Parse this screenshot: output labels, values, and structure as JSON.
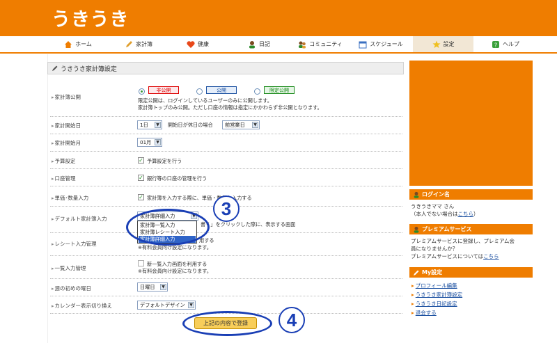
{
  "header": {
    "logo": "うきうき"
  },
  "nav": [
    {
      "label": "ホーム",
      "icon": "home-icon"
    },
    {
      "label": "家計簿",
      "icon": "pencil-icon"
    },
    {
      "label": "健康",
      "icon": "heart-icon"
    },
    {
      "label": "日記",
      "icon": "person-icon"
    },
    {
      "label": "コミュニティ",
      "icon": "people-icon"
    },
    {
      "label": "スケジュール",
      "icon": "calendar-icon"
    },
    {
      "label": "設定",
      "icon": "star-icon"
    },
    {
      "label": "ヘルプ",
      "icon": "help-icon"
    }
  ],
  "page": {
    "title": "うきうき家計簿設定"
  },
  "settings": {
    "visibility": {
      "label": "家計簿公開",
      "options": [
        "非公開",
        "公開",
        "限定公開"
      ],
      "desc1": "限定公開は、ログインしているユーザーのみに公開します。",
      "desc2": "家計簿トップのみ公開。ただし口座の情報は指定にかかわらず非公開となります。"
    },
    "start_day": {
      "label": "家計開始日",
      "value": "1日",
      "holiday_label": "開始日が休日の場合",
      "holiday_value": "前営業日"
    },
    "start_month": {
      "label": "家計開始月",
      "value": "01月"
    },
    "budget": {
      "label": "予算設定",
      "checkbox_label": "予算設定を行う"
    },
    "account": {
      "label": "口座管理",
      "checkbox_label": "銀行等の口座の管理を行う"
    },
    "unit_qty": {
      "label": "単価･数量入力",
      "checkbox_label": "家計簿を入力する際に、単価・数量も入力する"
    },
    "default_input": {
      "label": "デフォルト家計簿入力",
      "value": "家計簿詳細入力",
      "desc": "書く」をクリックした際に、表示する画面",
      "options": [
        "家計簿一覧入力",
        "家計簿レシート入力",
        "家計簿詳細入力"
      ]
    },
    "receipt": {
      "label": "レシート入力管理",
      "desc1": "用する",
      "desc2": "※有料会員向け設定になります。"
    },
    "list_input": {
      "label": "一覧入力管理",
      "checkbox_label": "新一覧入力画面を利用する",
      "desc": "※有料会員向け設定になります。"
    },
    "week_start": {
      "label": "週の初めの曜日",
      "value": "日曜日"
    },
    "calendar": {
      "label": "カレンダー表示切り換え",
      "value": "デフォルトデザイン"
    }
  },
  "submit_label": "上記の内容で登録",
  "annotations": {
    "step3": "3",
    "step4": "4"
  },
  "sidebar": {
    "login": {
      "heading": "ログイン名",
      "name": "うきうきママ さん",
      "note_prefix": "（本人でない場合は",
      "note_link": "こちら",
      "note_suffix": "）"
    },
    "premium": {
      "heading": "プレミアムサービス",
      "line1": "プレミアムサービスに登録し、プレミアム会",
      "line2": "員になりませんか？",
      "line3_prefix": "プレミアムサービスについては",
      "line3_link": "こちら"
    },
    "my_settings": {
      "heading": "My設定",
      "links": [
        "プロフィール編集",
        "うきうき家計簿設定",
        "うきうき日記設定",
        "退会する"
      ]
    }
  },
  "colors": {
    "brand": "#ef7d00",
    "annotation": "#1a3fb5"
  }
}
